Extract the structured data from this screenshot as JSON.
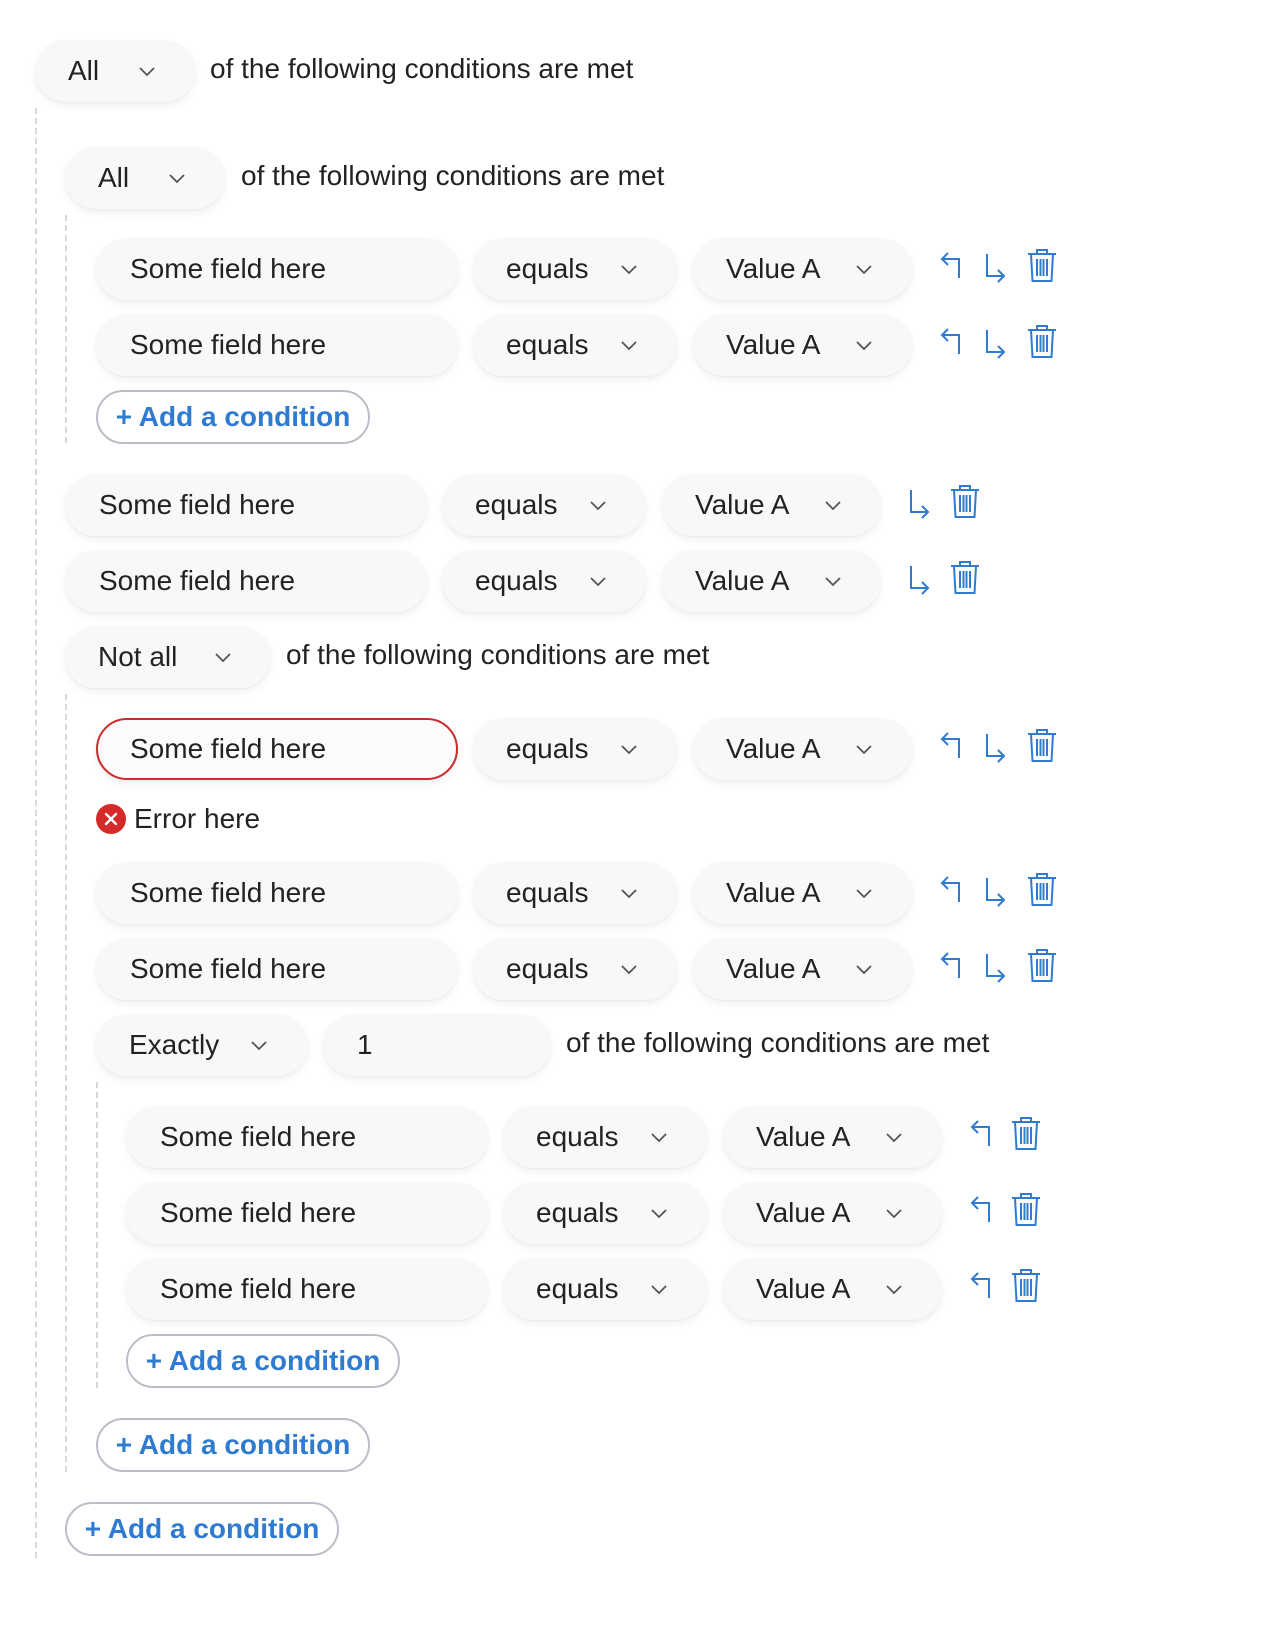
{
  "colors": {
    "accent": "#2f7bd0",
    "error": "#cc2b2b",
    "pill_bg": "#f7f8fa",
    "guide": "#d5d8de"
  },
  "icons": [
    "chevron-down-icon",
    "arrow-up-left-icon",
    "arrow-down-right-icon",
    "trash-icon",
    "error-x-icon"
  ],
  "root": {
    "quantifier": "All",
    "condition_text": "of the following conditions are met",
    "add_label": "+ Add a condition"
  },
  "group1": {
    "quantifier": "All",
    "condition_text": "of the following conditions are met",
    "rows": [
      {
        "field": "Some field here",
        "operator": "equals",
        "value": "Value A"
      },
      {
        "field": "Some field here",
        "operator": "equals",
        "value": "Value A"
      }
    ],
    "add_label": "+ Add a condition"
  },
  "root_rows": [
    {
      "field": "Some field here",
      "operator": "equals",
      "value": "Value A"
    },
    {
      "field": "Some field here",
      "operator": "equals",
      "value": "Value A"
    }
  ],
  "group2": {
    "quantifier": "Not all",
    "condition_text": "of the following conditions are met",
    "rows": [
      {
        "field": "Some field here",
        "operator": "equals",
        "value": "Value A",
        "error": "Error here"
      },
      {
        "field": "Some field here",
        "operator": "equals",
        "value": "Value A"
      },
      {
        "field": "Some field here",
        "operator": "equals",
        "value": "Value A"
      }
    ],
    "add_label": "+ Add a condition"
  },
  "group3": {
    "quantifier": "Exactly",
    "count": "1",
    "condition_text": "of the following conditions are met",
    "rows": [
      {
        "field": "Some field here",
        "operator": "equals",
        "value": "Value A"
      },
      {
        "field": "Some field here",
        "operator": "equals",
        "value": "Value A"
      },
      {
        "field": "Some field here",
        "operator": "equals",
        "value": "Value A"
      }
    ],
    "add_label": "+ Add a condition"
  }
}
